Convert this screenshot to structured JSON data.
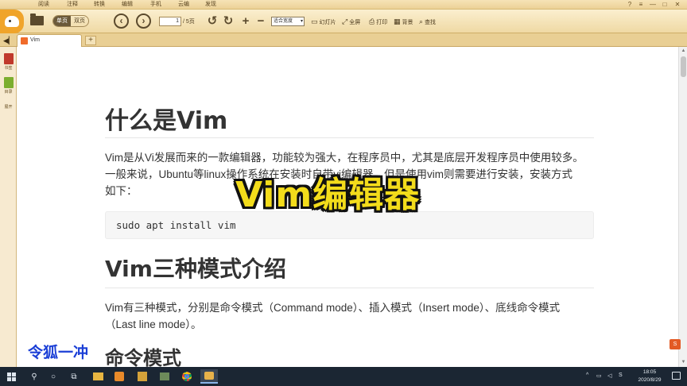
{
  "menubar": {
    "tabs": [
      "阅读",
      "注释",
      "转换",
      "编辑",
      "手机",
      "云编",
      "发现"
    ],
    "window_controls": [
      "?",
      "≡",
      "—",
      "□",
      "✕"
    ]
  },
  "toolbar": {
    "view_modes": [
      "单页",
      "双页"
    ],
    "page_current": "1",
    "page_total": "/ 5页",
    "zoom": "适合宽度",
    "buttons": {
      "slideshow": "幻灯片",
      "fullscreen": "全屏",
      "print": "打印",
      "background": "背景",
      "search": "查找"
    }
  },
  "tabs": {
    "active": "Vim",
    "add": "+"
  },
  "sidebar": {
    "items": [
      "书签",
      "目录",
      "展开"
    ]
  },
  "document": {
    "h1": "什么是Vim",
    "intro_lines": [
      "Vim是从Vi发展而来的一款编辑器，功能较为强大，在程序员中，尤其是底层开发程序员中使用较多。",
      "一般来说，Ubuntu等linux操作系统在安装时自带vi编辑器，但是使用vim则需要进行安装，安装方式",
      "如下："
    ],
    "code": "sudo apt install vim",
    "h2": "Vim三种模式介绍",
    "modes_lines": [
      "Vim有三种模式，分别是命令模式（Command mode）、插入模式（Insert mode）、底线命令模式",
      "（Last line mode）。"
    ],
    "h3": "命令模式"
  },
  "overlay": {
    "title": "Vim编辑器",
    "watermark": "令狐一冲"
  },
  "taskbar": {
    "time": "18:05",
    "date": "2020/8/29",
    "tray_icons": [
      "^",
      "network-icon",
      "volume-icon",
      "ime-icon"
    ]
  },
  "colors": {
    "toolbar_bg": "#efd9a4",
    "overlay_yellow": "#f3dc1b",
    "watermark_blue": "#1b3fd6",
    "taskbar_bg": "#1b2633"
  }
}
